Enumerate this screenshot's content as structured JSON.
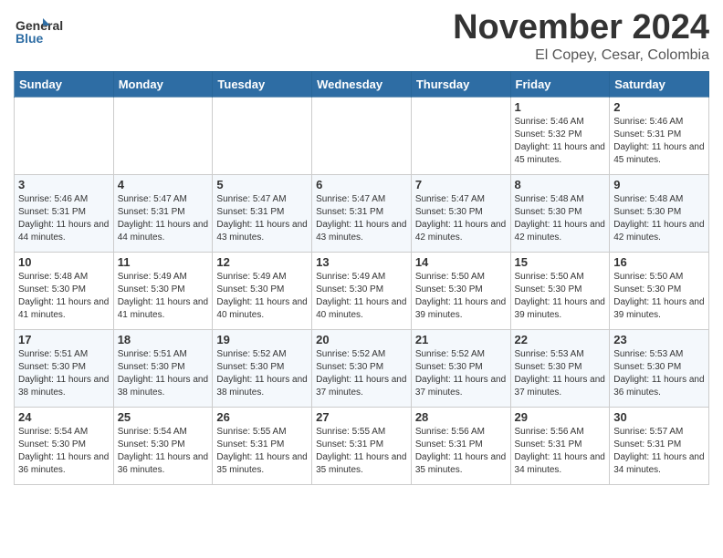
{
  "header": {
    "logo_line1": "General",
    "logo_line2": "Blue",
    "month_title": "November 2024",
    "location": "El Copey, Cesar, Colombia"
  },
  "weekdays": [
    "Sunday",
    "Monday",
    "Tuesday",
    "Wednesday",
    "Thursday",
    "Friday",
    "Saturday"
  ],
  "weeks": [
    [
      {
        "day": "",
        "info": ""
      },
      {
        "day": "",
        "info": ""
      },
      {
        "day": "",
        "info": ""
      },
      {
        "day": "",
        "info": ""
      },
      {
        "day": "",
        "info": ""
      },
      {
        "day": "1",
        "info": "Sunrise: 5:46 AM\nSunset: 5:32 PM\nDaylight: 11 hours and 45 minutes."
      },
      {
        "day": "2",
        "info": "Sunrise: 5:46 AM\nSunset: 5:31 PM\nDaylight: 11 hours and 45 minutes."
      }
    ],
    [
      {
        "day": "3",
        "info": "Sunrise: 5:46 AM\nSunset: 5:31 PM\nDaylight: 11 hours and 44 minutes."
      },
      {
        "day": "4",
        "info": "Sunrise: 5:47 AM\nSunset: 5:31 PM\nDaylight: 11 hours and 44 minutes."
      },
      {
        "day": "5",
        "info": "Sunrise: 5:47 AM\nSunset: 5:31 PM\nDaylight: 11 hours and 43 minutes."
      },
      {
        "day": "6",
        "info": "Sunrise: 5:47 AM\nSunset: 5:31 PM\nDaylight: 11 hours and 43 minutes."
      },
      {
        "day": "7",
        "info": "Sunrise: 5:47 AM\nSunset: 5:30 PM\nDaylight: 11 hours and 42 minutes."
      },
      {
        "day": "8",
        "info": "Sunrise: 5:48 AM\nSunset: 5:30 PM\nDaylight: 11 hours and 42 minutes."
      },
      {
        "day": "9",
        "info": "Sunrise: 5:48 AM\nSunset: 5:30 PM\nDaylight: 11 hours and 42 minutes."
      }
    ],
    [
      {
        "day": "10",
        "info": "Sunrise: 5:48 AM\nSunset: 5:30 PM\nDaylight: 11 hours and 41 minutes."
      },
      {
        "day": "11",
        "info": "Sunrise: 5:49 AM\nSunset: 5:30 PM\nDaylight: 11 hours and 41 minutes."
      },
      {
        "day": "12",
        "info": "Sunrise: 5:49 AM\nSunset: 5:30 PM\nDaylight: 11 hours and 40 minutes."
      },
      {
        "day": "13",
        "info": "Sunrise: 5:49 AM\nSunset: 5:30 PM\nDaylight: 11 hours and 40 minutes."
      },
      {
        "day": "14",
        "info": "Sunrise: 5:50 AM\nSunset: 5:30 PM\nDaylight: 11 hours and 39 minutes."
      },
      {
        "day": "15",
        "info": "Sunrise: 5:50 AM\nSunset: 5:30 PM\nDaylight: 11 hours and 39 minutes."
      },
      {
        "day": "16",
        "info": "Sunrise: 5:50 AM\nSunset: 5:30 PM\nDaylight: 11 hours and 39 minutes."
      }
    ],
    [
      {
        "day": "17",
        "info": "Sunrise: 5:51 AM\nSunset: 5:30 PM\nDaylight: 11 hours and 38 minutes."
      },
      {
        "day": "18",
        "info": "Sunrise: 5:51 AM\nSunset: 5:30 PM\nDaylight: 11 hours and 38 minutes."
      },
      {
        "day": "19",
        "info": "Sunrise: 5:52 AM\nSunset: 5:30 PM\nDaylight: 11 hours and 38 minutes."
      },
      {
        "day": "20",
        "info": "Sunrise: 5:52 AM\nSunset: 5:30 PM\nDaylight: 11 hours and 37 minutes."
      },
      {
        "day": "21",
        "info": "Sunrise: 5:52 AM\nSunset: 5:30 PM\nDaylight: 11 hours and 37 minutes."
      },
      {
        "day": "22",
        "info": "Sunrise: 5:53 AM\nSunset: 5:30 PM\nDaylight: 11 hours and 37 minutes."
      },
      {
        "day": "23",
        "info": "Sunrise: 5:53 AM\nSunset: 5:30 PM\nDaylight: 11 hours and 36 minutes."
      }
    ],
    [
      {
        "day": "24",
        "info": "Sunrise: 5:54 AM\nSunset: 5:30 PM\nDaylight: 11 hours and 36 minutes."
      },
      {
        "day": "25",
        "info": "Sunrise: 5:54 AM\nSunset: 5:30 PM\nDaylight: 11 hours and 36 minutes."
      },
      {
        "day": "26",
        "info": "Sunrise: 5:55 AM\nSunset: 5:31 PM\nDaylight: 11 hours and 35 minutes."
      },
      {
        "day": "27",
        "info": "Sunrise: 5:55 AM\nSunset: 5:31 PM\nDaylight: 11 hours and 35 minutes."
      },
      {
        "day": "28",
        "info": "Sunrise: 5:56 AM\nSunset: 5:31 PM\nDaylight: 11 hours and 35 minutes."
      },
      {
        "day": "29",
        "info": "Sunrise: 5:56 AM\nSunset: 5:31 PM\nDaylight: 11 hours and 34 minutes."
      },
      {
        "day": "30",
        "info": "Sunrise: 5:57 AM\nSunset: 5:31 PM\nDaylight: 11 hours and 34 minutes."
      }
    ]
  ]
}
